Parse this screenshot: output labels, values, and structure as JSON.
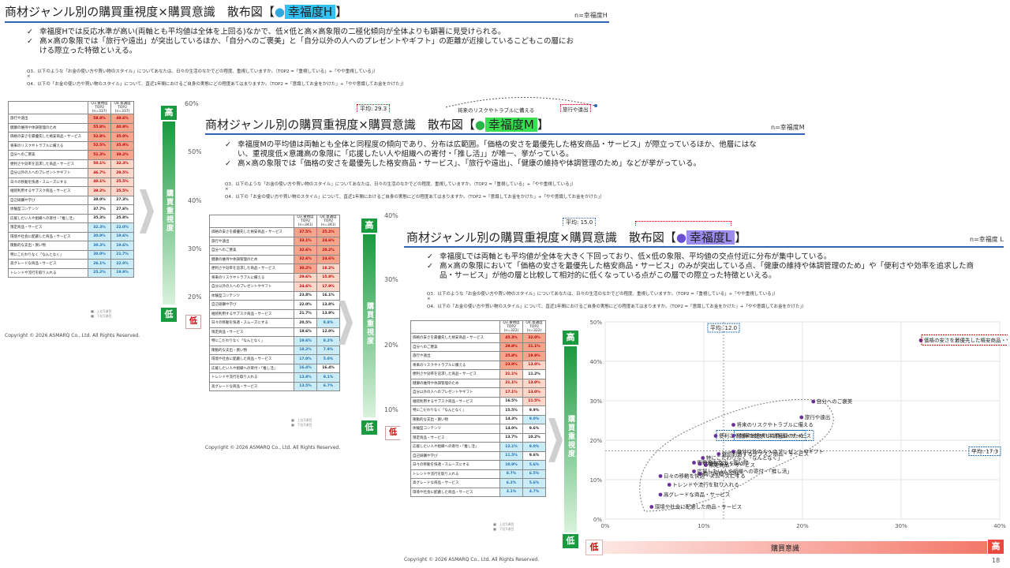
{
  "slides": [
    {
      "title_prefix": "商材ジャンル別の購買重視度×購買意識　散布図【",
      "title_dot": "●",
      "title_highlight": "幸福度H",
      "title_suffix": "】",
      "n_label": "n=幸福度H",
      "bullets": [
        "幸福度Hでは反応水準が高い(両軸とも平均値は全体を上回る)なかで、低×低と高×高象限の二極化傾向が全体よりも顕著に見受けられる。",
        "高×高の象限では「旅行や遠出」が突出しているほか、「自分へのご褒美」と「自分以外の人へのプレゼントやギフト」の距離が近接しているこどもこの層における際立った特徴といえる。"
      ],
      "q3": "Q3．以下のような「お金の使い方や買い物のスタイル」についてあなたは、日々の生活のなかでどの程度、重視していますか。（TOP2 =「重視している」+「やや重視している」）",
      "x_mark": "×",
      "q4": "Q4．以下の「お金の使い方や買い物のスタイル」について、直近1年間におけるご自身の実態にどの程度あてはまりますか。（TOP2 =「意識してお金をかけた」+「やや意識してお金をかけた」）",
      "table_header": [
        "",
        "Q3.重視度\nTOP2\n(n=337)",
        "Q4.意識度\nTOP2\n(n=337)"
      ],
      "rows": [
        [
          "旅行や遠出",
          "58.8%",
          "49.6%",
          "c-red",
          "c-red"
        ],
        [
          "健康の維持や体調管理のため",
          "55.8%",
          "40.9%",
          "c-red",
          "c-red"
        ],
        [
          "価格の安さを最優先した格安商品・サービス",
          "52.8%",
          "35.0%",
          "c-red",
          "c-red"
        ],
        [
          "将来のリスクやトラブルに備える",
          "52.5%",
          "35.9%",
          "c-red",
          "c-red"
        ],
        [
          "自分へのご褒美",
          "51.3%",
          "39.2%",
          "c-red",
          "c-red"
        ],
        [
          "便利さや効率を追求した商品・サービス",
          "50.1%",
          "32.3%",
          "c-pink",
          "c-pink"
        ],
        [
          "自分以外の人へのプレゼントやギフト",
          "46.7%",
          "29.5%",
          "c-pink",
          "c-pink"
        ],
        [
          "日々の移動を快適・スムーズにする",
          "40.1%",
          "25.5%",
          "c-pink",
          "c-pink"
        ],
        [
          "継続利用するサブスク商品・サービス",
          "39.2%",
          "25.5%",
          "c-pink",
          "c-pink"
        ],
        [
          "自己研鑽や学び",
          "38.0%",
          "27.3%",
          "c-plain",
          "c-plain"
        ],
        [
          "体験型コンテンツ",
          "37.7%",
          "27.6%",
          "c-plain",
          "c-plain"
        ],
        [
          "応援したい人や組織への寄付・「推し活」",
          "35.3%",
          "25.8%",
          "c-plain",
          "c-plain"
        ],
        [
          "限定商品・サービス",
          "32.3%",
          "22.0%",
          "c-blue",
          "c-blue"
        ],
        [
          "環境や社会に配慮した商品・サービス",
          "30.9%",
          "19.6%",
          "c-blue",
          "c-blue"
        ],
        [
          "衝動的な支出・買い物",
          "30.3%",
          "19.6%",
          "c-blue",
          "c-blue"
        ],
        [
          "特にこだわりなく「なんとなく」",
          "30.0%",
          "21.7%",
          "c-blue",
          "c-blue"
        ],
        [
          "高グレードな商品・サービス",
          "26.1%",
          "22.0%",
          "c-blue",
          "c-blue"
        ],
        [
          "トレンドや流行を取り入れる",
          "25.2%",
          "19.9%",
          "c-blue",
          "c-blue"
        ]
      ],
      "legend": [
        "■：上位5項目",
        "■：下位5項目"
      ],
      "y_ticks": [
        "60%",
        "50%",
        "40%",
        "30%",
        "20%"
      ],
      "high": "高",
      "low": "低",
      "axis_y_label": "購買重視度",
      "avg_label": "平均: 29.3",
      "peek_labels": [
        "将来のリスクやトラブルに備える",
        "旅行や遠出"
      ],
      "copyright": "Copyright © 2026 ASMARQ Co., Ltd. All Rights Reserved."
    },
    {
      "title_prefix": "商材ジャンル別の購買重視度×購買意識　散布図【",
      "title_dot": "●",
      "title_highlight": "幸福度M",
      "title_suffix": "】",
      "n_label": "n=幸福度M",
      "bullets": [
        "幸福度Mの平均値は両軸とも全体と同程度の傾向であり、分布は広範囲。「価格の安さを最優先した格安商品・サービス」が際立っているほか、他層にはない、重視度低×意識高の象限に「応援したい人や組織への寄付・「推し活」」が唯一、挙がっている。",
        "高×高の象限では「価格の安さを最優先した格安商品・サービス」、「旅行や遠出」、「健康の維持や体調管理のため」などが挙がっている。"
      ],
      "q3": "Q3．以下のような「お金の使い方や買い物のスタイル」についてあなたは、日々の生活のなかでどの程度、重視していますか。（TOP2 =「重視している」+「やや重視している」）",
      "x_mark": "×",
      "q4": "Q4．以下の「お金の使い方や買い物のスタイル」について、直近1年間におけるご自身の実態にどの程度あてはまりますか。（TOP2 =「意識してお金をかけた」+「やや意識してお金をかけた」）",
      "table_header": [
        "",
        "Q3.重視度\nTOP2\n(n=341)",
        "Q4.意識度\nTOP2\n(n=341)"
      ],
      "rows": [
        [
          "価格の安さを最優先した格安商品・サービス",
          "37.5%",
          "25.2%",
          "c-red",
          "c-red"
        ],
        [
          "旅行や遠出",
          "33.1%",
          "24.6%",
          "c-red",
          "c-red"
        ],
        [
          "自分へのご褒美",
          "32.6%",
          "20.2%",
          "c-red",
          "c-red"
        ],
        [
          "健康の維持や体調管理のため",
          "32.6%",
          "24.6%",
          "c-red",
          "c-red"
        ],
        [
          "便利さや効率を追求した商品・サービス",
          "30.2%",
          "18.2%",
          "c-red",
          "c-pink"
        ],
        [
          "将来のリスクやトラブルに備える",
          "29.6%",
          "15.8%",
          "c-pink",
          "c-pink"
        ],
        [
          "自分以外の人へのプレゼントやギフト",
          "24.6%",
          "17.9%",
          "c-pink",
          "c-pink"
        ],
        [
          "体験型コンテンツ",
          "23.8%",
          "16.1%",
          "c-plain",
          "c-plain"
        ],
        [
          "自己研鑽や学び",
          "22.0%",
          "13.8%",
          "c-plain",
          "c-plain"
        ],
        [
          "継続利用するサブスク商品・サービス",
          "21.7%",
          "13.9%",
          "c-plain",
          "c-plain"
        ],
        [
          "日々の移動を快適・スムーズにする",
          "20.5%",
          "8.8%",
          "c-plain",
          "c-blue"
        ],
        [
          "限定商品・サービス",
          "19.6%",
          "12.0%",
          "c-plain",
          "c-plain"
        ],
        [
          "特にこだわりなく「なんとなく」",
          "19.6%",
          "8.2%",
          "c-blue",
          "c-blue"
        ],
        [
          "衝動的な支出・買い物",
          "18.2%",
          "7.9%",
          "c-blue",
          "c-blue"
        ],
        [
          "環境や社会に配慮した商品・サービス",
          "17.0%",
          "5.0%",
          "c-blue",
          "c-blue"
        ],
        [
          "応援したい人や組織への寄付・「推し活」",
          "16.4%",
          "16.4%",
          "c-blue",
          "c-plain"
        ],
        [
          "トレンドや流行を取り入れる",
          "13.8%",
          "9.1%",
          "c-blue",
          "c-blue"
        ],
        [
          "高グレードな商品・サービス",
          "13.5%",
          "6.7%",
          "c-blue",
          "c-blue"
        ]
      ],
      "legend": [
        "■：上位5項目",
        "■：下位5項目"
      ],
      "y_ticks": [
        "40%",
        "30%",
        "20%",
        "10%"
      ],
      "high": "高",
      "low": "低",
      "axis_y_label": "購買重視度",
      "avg_label": "平均: 15.0",
      "copyright": "Copyright © 2026 ASMARQ Co., Ltd. All Rights Reserved."
    },
    {
      "title_prefix": "商材ジャンル別の購買重視度×購買意識　散布図【",
      "title_dot": "●",
      "title_highlight": "幸福度L",
      "title_suffix": "】",
      "n_label": "n=幸福度 L",
      "bullets": [
        "幸福度Lでは両軸とも平均値が全体を大きく下回っており、低×低の象限、平均値の交点付近に分布が集中している。",
        "高×高の象限において「価格の安さを最優先した格安商品・サービス」のみが突出している点、「健康の維持や体調管理のため」や「便利さや効率を追求した商品・サービス」が他の層と比較して相対的に低くなっている点がこの層での際立った特徴といえる。"
      ],
      "q3": "Q3．以下のような「お金の使い方や買い物のスタイル」についてあなたは、日々の生活のなかでどの程度、重視していますか。（TOP2 =「重視している」+「やや重視している」）",
      "x_mark": "×",
      "q4": "Q4．以下の「お金の使い方や買い物のスタイル」について、直近1年間におけるご自身の実態にどの程度あてはまりますか。（TOP2 =「意識してお金をかけた」+「やや意識してお金をかけた」）",
      "table_header": [
        "",
        "Q3.重視度\nTOP2\n(n=322)",
        "Q4.意識度\nTOP2\n(n=322)"
      ],
      "rows": [
        [
          "価格の安さを最優先した格安商品・サービス",
          "45.3%",
          "32.0%",
          "c-red",
          "c-red"
        ],
        [
          "自分へのご褒美",
          "29.8%",
          "21.1%",
          "c-red",
          "c-red"
        ],
        [
          "旅行や遠出",
          "25.8%",
          "19.9%",
          "c-red",
          "c-red"
        ],
        [
          "将来のリスクやトラブルに備える",
          "23.9%",
          "13.0%",
          "c-red",
          "c-pink"
        ],
        [
          "便利さや効率を追求した商品・サービス",
          "21.1%",
          "11.2%",
          "c-pink",
          "c-plain"
        ],
        [
          "健康の維持や体調管理のため",
          "21.1%",
          "13.0%",
          "c-pink",
          "c-pink"
        ],
        [
          "自分以外の人へのプレゼントやギフト",
          "17.1%",
          "13.0%",
          "c-pink",
          "c-pink"
        ],
        [
          "継続利用するサブスク商品・サービス",
          "16.5%",
          "11.5%",
          "c-plain",
          "c-pink"
        ],
        [
          "特にこだわりなく「なんとなく」",
          "15.5%",
          "9.9%",
          "c-plain",
          "c-plain"
        ],
        [
          "衝動的な支出・買い物",
          "14.3%",
          "9.0%",
          "c-plain",
          "c-blue"
        ],
        [
          "体験型コンテンツ",
          "14.0%",
          "9.6%",
          "c-plain",
          "c-plain"
        ],
        [
          "限定商品・サービス",
          "13.7%",
          "10.2%",
          "c-plain",
          "c-plain"
        ],
        [
          "応援したい人や組織への寄付・「推し活」",
          "12.1%",
          "9.0%",
          "c-blue",
          "c-blue"
        ],
        [
          "自己研鑽や学び",
          "11.5%",
          "9.6%",
          "c-blue",
          "c-plain"
        ],
        [
          "日々の移動を快適・スムーズにする",
          "10.9%",
          "5.6%",
          "c-blue",
          "c-blue"
        ],
        [
          "トレンドや流行を取り入れる",
          "8.7%",
          "6.5%",
          "c-blue",
          "c-blue"
        ],
        [
          "高グレードな商品・サービス",
          "6.2%",
          "5.6%",
          "c-blue",
          "c-blue"
        ],
        [
          "環境や社会に配慮した商品・サービス",
          "3.1%",
          "4.7%",
          "c-blue",
          "c-blue"
        ]
      ],
      "legend": [
        "■：上位5項目",
        "■：下位5項目"
      ],
      "y_ticks": [
        "50%",
        "40%",
        "30%",
        "20%",
        "10%",
        "0%"
      ],
      "x_ticks": [
        "0%",
        "10%",
        "20%",
        "30%",
        "40%"
      ],
      "high": "高",
      "low": "低",
      "axis_y_label": "購買重視度",
      "axis_x_label": "購買意識",
      "avg_x_label": "平均: 12.0",
      "avg_y_label": "平均: 17.3",
      "copyright": "Copyright © 2026 ASMARQ Co., Ltd. All Rights Reserved.",
      "page_number": "18"
    }
  ],
  "chart_data": {
    "type": "scatter",
    "title": "",
    "xlabel": "購買意識",
    "ylabel": "購買重視度",
    "xlim": [
      0,
      40
    ],
    "ylim": [
      0,
      50
    ],
    "x_avg": 12.0,
    "y_avg": 17.3,
    "points": [
      {
        "label": "価格の安さを最優先した格安商品・サービス",
        "x": 32.0,
        "y": 45.3,
        "callout": true
      },
      {
        "label": "自分へのご褒美",
        "x": 21.1,
        "y": 29.8
      },
      {
        "label": "旅行や遠出",
        "x": 19.9,
        "y": 25.8
      },
      {
        "label": "将来のリスクやトラブルに備える",
        "x": 13.0,
        "y": 23.9
      },
      {
        "label": "便利さや効率を追求した商品・サービス",
        "x": 11.2,
        "y": 21.1,
        "callout": true
      },
      {
        "label": "健康の維持や体調管理のため",
        "x": 13.0,
        "y": 21.1,
        "callout": true
      },
      {
        "label": "自分以外の人へのプレゼントやギフト",
        "x": 13.0,
        "y": 17.1
      },
      {
        "label": "継続利用するサブスク商品・サービス",
        "x": 11.5,
        "y": 16.5
      },
      {
        "label": "特にこだわりなく「なんとなく」",
        "x": 9.9,
        "y": 15.5
      },
      {
        "label": "衝動的な支出・買い物",
        "x": 9.0,
        "y": 14.3
      },
      {
        "label": "体験型コンテンツ",
        "x": 9.6,
        "y": 14.0
      },
      {
        "label": "限定商品・サービス",
        "x": 10.2,
        "y": 13.7
      },
      {
        "label": "応援したい人や組織への寄付・「推し活」",
        "x": 9.0,
        "y": 12.1
      },
      {
        "label": "自己研鑽や学び",
        "x": 9.6,
        "y": 11.5
      },
      {
        "label": "日々の移動を快適・スムーズにする",
        "x": 5.6,
        "y": 10.9
      },
      {
        "label": "トレンドや流行を取り入れる",
        "x": 6.5,
        "y": 8.7
      },
      {
        "label": "高グレードな商品・サービス",
        "x": 5.6,
        "y": 6.2
      },
      {
        "label": "環境や社会に配慮した商品・サービス",
        "x": 4.7,
        "y": 3.1
      }
    ]
  }
}
